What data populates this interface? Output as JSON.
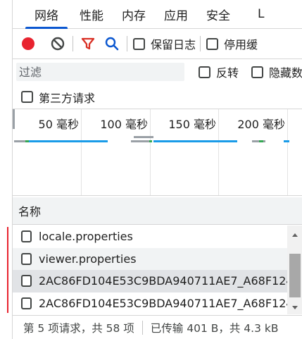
{
  "tabs": [
    "网络",
    "性能",
    "内存",
    "应用",
    "安全",
    "L"
  ],
  "active_tab": 0,
  "toolbar": {
    "record_icon": "record-icon",
    "clear_icon": "clear-icon",
    "filter_icon": "filter-icon",
    "search_icon": "search-icon",
    "preserve_log": "保留日志",
    "disable_cache": "停用缓"
  },
  "filter": {
    "placeholder": "过滤",
    "invert": "反转",
    "hide": "隐藏数"
  },
  "third_party": "第三方请求",
  "timeline": {
    "ticks": [
      "50 毫秒",
      "100 毫秒",
      "150 毫秒",
      "200 毫秒"
    ]
  },
  "table": {
    "header": "名称",
    "rows": [
      "locale.properties",
      "viewer.properties",
      "2AC86FD104E53C9BDA940711AE7_A68F124",
      "2AC86FD104E53C9BDA940711AE7_A68F124"
    ]
  },
  "status": {
    "requests": "第 5 项请求，共 58 项",
    "transferred": "已传输 401 B，共 4.3 kB"
  },
  "colors": {
    "accent": "#0b57d0",
    "record": "#e8232f",
    "filter_active": "#d93025",
    "timeline_blue": "#1a9be8",
    "timeline_green": "#34a853"
  }
}
